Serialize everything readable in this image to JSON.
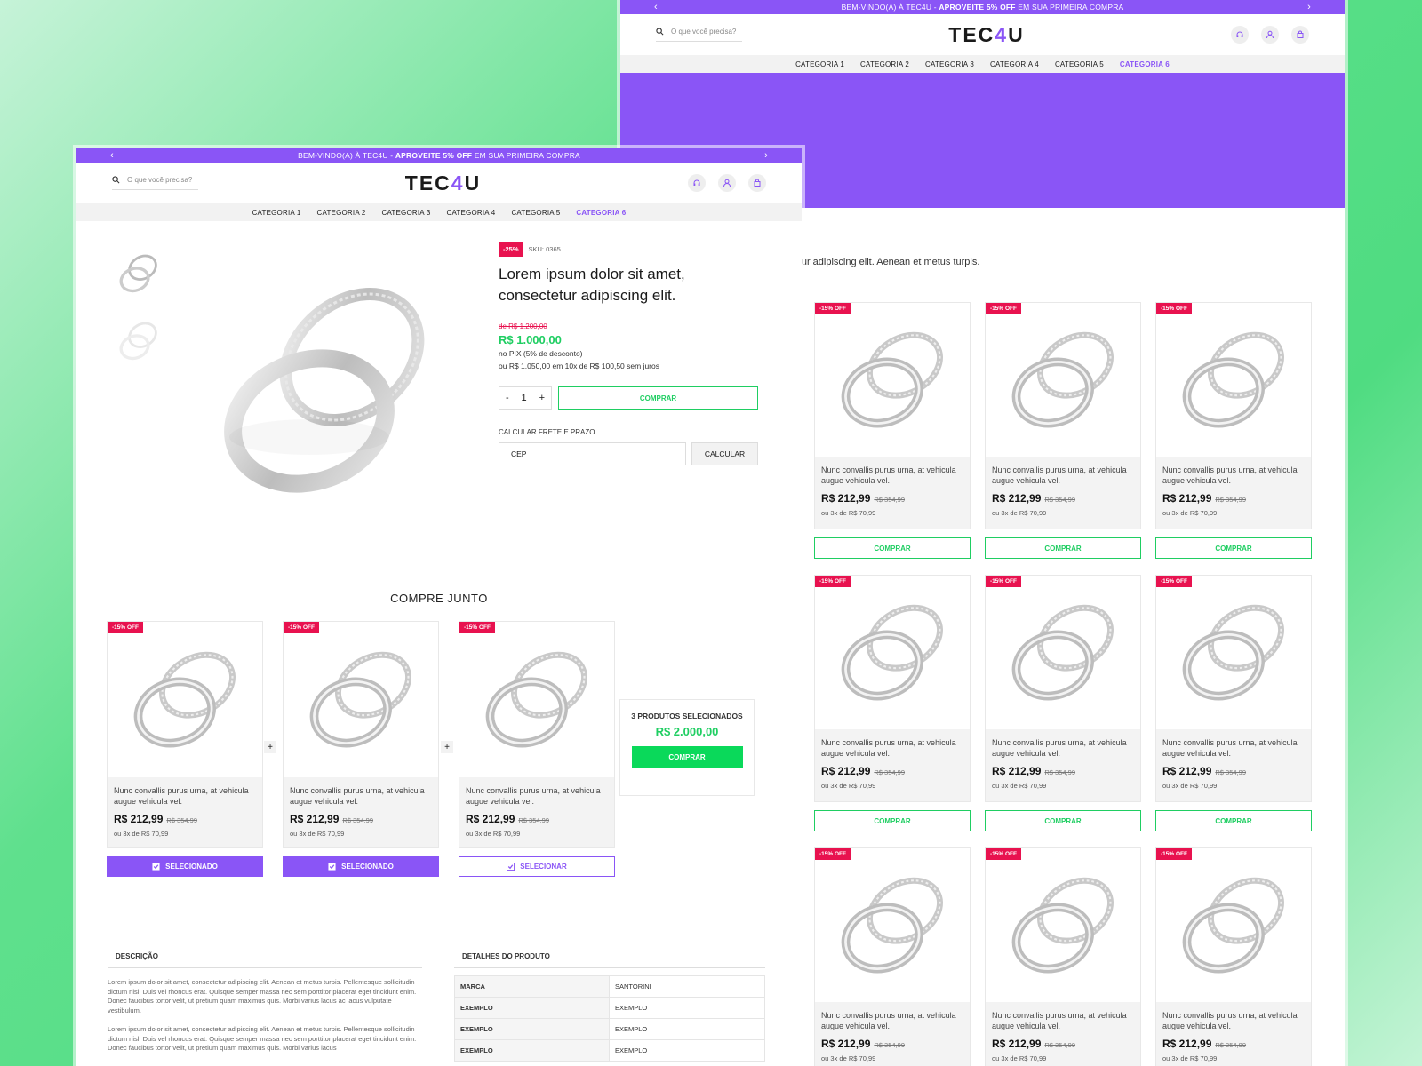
{
  "promo": {
    "prefix": "BEM-VINDO(A) À TEC4U - ",
    "bold": "APROVEITE 5% OFF",
    "suffix": " EM SUA PRIMEIRA COMPRA"
  },
  "header": {
    "search_placeholder": "O que você precisa?",
    "logo_a": "TEC",
    "logo_b": "4",
    "logo_c": "U"
  },
  "nav": [
    "CATEGORIA 1",
    "CATEGORIA 2",
    "CATEGORIA 3",
    "CATEGORIA 4",
    "CATEGORIA 5",
    "CATEGORIA 6"
  ],
  "nav_active_index": 5,
  "colors": {
    "brand": "#8a55f6",
    "green": "#1fce62",
    "sale": "#e8124f"
  },
  "listing": {
    "intro": "ectetur adipiscing elit. Aenean et metus turpis."
  },
  "product_card": {
    "badge": "-15% OFF",
    "name": "Nunc convallis purus urna, at vehicula augue vehicula vel.",
    "price": "R$ 212,99",
    "old_price": "R$ 354,99",
    "installments": "ou 3x de R$ 70,99",
    "buy_label": "COMPRAR"
  },
  "product": {
    "discount": "-25%",
    "sku": "SKU: 0365",
    "title": "Lorem ipsum dolor sit amet, consectetur adipiscing elit.",
    "old_price": "de R$ 1.200,00",
    "price": "R$ 1.000,00",
    "pix": "no PIX (5% de desconto)",
    "installments": "ou R$ 1.050,00 em 10x de R$ 100,50 sem juros",
    "qty": "1",
    "qty_minus": "-",
    "qty_plus": "+",
    "buy_label": "COMPRAR",
    "shipping_label": "CALCULAR FRETE E PRAZO",
    "cep_placeholder": "CEP",
    "calc_label": "CALCULAR"
  },
  "bundle": {
    "title": "COMPRE JUNTO",
    "selected_label": "SELECIONADO",
    "select_label": "SELECIONAR",
    "plus": "+",
    "summary_count": "3 PRODUTOS SELECIONADOS",
    "summary_total": "R$ 2.000,00",
    "summary_buy": "COMPRAR"
  },
  "description": {
    "title": "DESCRIÇÃO",
    "p1": "Lorem ipsum dolor sit amet, consectetur adipiscing elit. Aenean et metus turpis. Pellentesque sollicitudin dictum nisl. Duis vel rhoncus erat. Quisque semper massa nec sem porttitor placerat eget tincidunt enim. Donec faucibus tortor velit, ut pretium quam maximus quis. Morbi varius lacus ac lacus vulputate vestibulum.",
    "p2": "Lorem ipsum dolor sit amet, consectetur adipiscing elit. Aenean et metus turpis. Pellentesque sollicitudin dictum nisl. Duis vel rhoncus erat. Quisque semper massa nec sem porttitor placerat eget tincidunt enim. Donec faucibus tortor velit, ut pretium quam maximus quis. Morbi varius lacus"
  },
  "details": {
    "title": "DETALHES DO PRODUTO",
    "rows": [
      {
        "k": "MARCA",
        "v": "SANTORINI"
      },
      {
        "k": "EXEMPLO",
        "v": "EXEMPLO"
      },
      {
        "k": "EXEMPLO",
        "v": "EXEMPLO"
      },
      {
        "k": "EXEMPLO",
        "v": "EXEMPLO"
      }
    ]
  }
}
